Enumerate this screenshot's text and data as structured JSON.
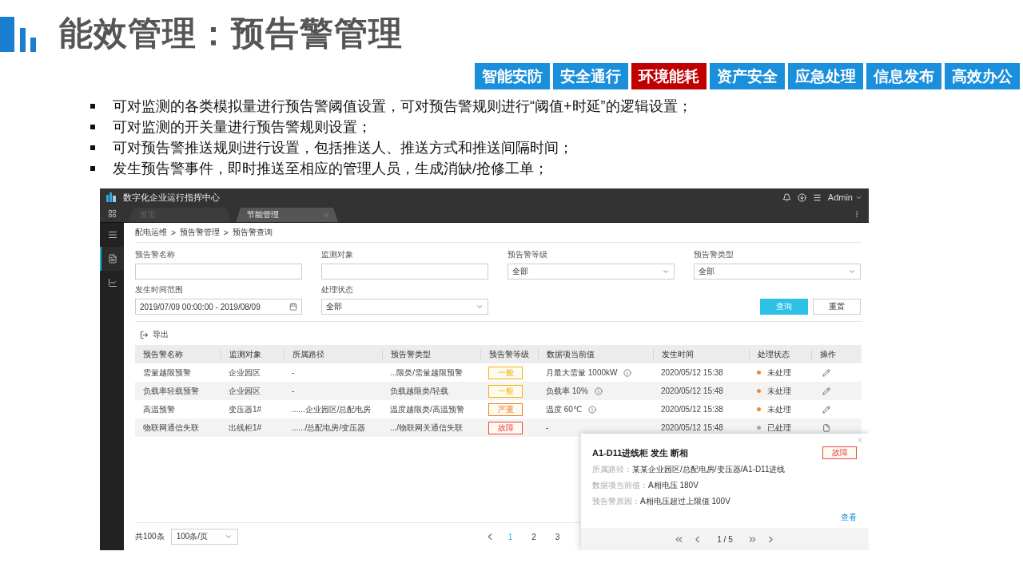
{
  "title": "能效管理：预告警管理",
  "category_tabs": [
    {
      "label": "智能安防",
      "selected": false
    },
    {
      "label": "安全通行",
      "selected": false
    },
    {
      "label": "环境能耗",
      "selected": true
    },
    {
      "label": "资产安全",
      "selected": false
    },
    {
      "label": "应急处理",
      "selected": false
    },
    {
      "label": "信息发布",
      "selected": false
    },
    {
      "label": "高效办公",
      "selected": false
    }
  ],
  "bullets": [
    "可对监测的各类模拟量进行预告警阈值设置，可对预告警规则进行“阈值+时延”的逻辑设置；",
    "可对监测的开关量进行预告警规则设置；",
    "可对预告警推送规则进行设置，包括推送人、推送方式和推送间隔时间；",
    "发生预告警事件，即时推送至相应的管理人员，生成消缺/抢修工单；"
  ],
  "app": {
    "title": "数字化企业运行指挥中心",
    "user": "Admin",
    "tabs": [
      {
        "label": "首页",
        "selected": false
      },
      {
        "label": "节能管理",
        "selected": true
      }
    ],
    "sidebar": [
      {
        "kind": "menu",
        "selected": false
      },
      {
        "kind": "document",
        "selected": true
      },
      {
        "kind": "chart",
        "selected": false
      }
    ],
    "breadcrumb": {
      "separator": ">",
      "items": [
        "配电运维",
        "预告警管理",
        "预告警查询"
      ]
    },
    "filters": [
      {
        "label": "预告警名称",
        "kind": "input"
      },
      {
        "label": "监测对象",
        "kind": "input"
      },
      {
        "label": "预告警等级",
        "kind": "select",
        "value": "全部"
      },
      {
        "label": "预告警类型",
        "kind": "select",
        "value": "全部"
      },
      {
        "label": "发生时间范围",
        "kind": "date",
        "value": "2019/07/09 00:00:00 - 2019/08/09"
      },
      {
        "label": "处理状态",
        "kind": "select",
        "value": "全部"
      }
    ],
    "buttons": [
      {
        "label": "查询",
        "kind": "primary"
      },
      {
        "label": "重置",
        "kind": "default"
      }
    ],
    "export": "导出",
    "table": {
      "columns": [
        "预告警名称",
        "监测对象",
        "所属路径",
        "预告警类型",
        "预告警等级",
        "数据项当前值",
        "发生时间",
        "处理状态",
        "操作"
      ],
      "rows": [
        {
          "name": "需量越限预警",
          "object": "企业园区",
          "path": "-",
          "type": "...限类/需量越限预警",
          "level": {
            "label": "一般",
            "color": "#f0b400"
          },
          "value": "月最大需量 1000kW",
          "info": true,
          "time": "2020/05/12 15:38",
          "status": {
            "label": "未处理",
            "color": "#f08a24"
          },
          "action": {
            "kind": "edit"
          }
        },
        {
          "name": "负载率轻载预警",
          "object": "企业园区",
          "path": "-",
          "type": "负载越限类/轻载",
          "level": {
            "label": "一般",
            "color": "#f0b400"
          },
          "value": "负载率 10%",
          "info": true,
          "time": "2020/05/12 15:48",
          "status": {
            "label": "未处理",
            "color": "#f08a24"
          },
          "action": {
            "kind": "edit"
          }
        },
        {
          "name": "高温预警",
          "object": "变压器1#",
          "path": "......企业园区/总配电房",
          "type": "温度越限类/高温预警",
          "level": {
            "label": "严重",
            "color": "#f07d2a"
          },
          "value": "温度 60℃",
          "info": true,
          "time": "2020/05/12 15:38",
          "status": {
            "label": "未处理",
            "color": "#f08a24"
          },
          "action": {
            "kind": "edit"
          }
        },
        {
          "name": "物联网通信失联",
          "object": "出线柜1#",
          "path": "....../总配电房/变压器",
          "type": ".../物联网关通信失联",
          "level": {
            "label": "故障",
            "color": "#e84545"
          },
          "value": "-",
          "info": false,
          "time": "2020/05/12 15:48",
          "status": {
            "label": "已处理",
            "color": "#aaaaaa"
          },
          "action": {
            "kind": "view"
          }
        }
      ]
    },
    "pagination": {
      "total": "共100条",
      "page_size": "100条/页",
      "pages": [
        {
          "label": "1",
          "selected": true
        },
        {
          "label": "2",
          "selected": false
        },
        {
          "label": "3",
          "selected": false
        }
      ]
    },
    "popup": {
      "title": "A1-D11进线柜 发生 断相",
      "badge": "故障",
      "fields": [
        {
          "label": "所属路径：",
          "value": "某某企业园区/总配电房/变压器/A1-D11进线"
        },
        {
          "label": "数据项当前值：",
          "value": "A相电压 180V"
        },
        {
          "label": "预告警原因：",
          "value": "A相电压超过上限值 100V"
        }
      ],
      "link": "查看",
      "pager": "1 / 5"
    }
  }
}
